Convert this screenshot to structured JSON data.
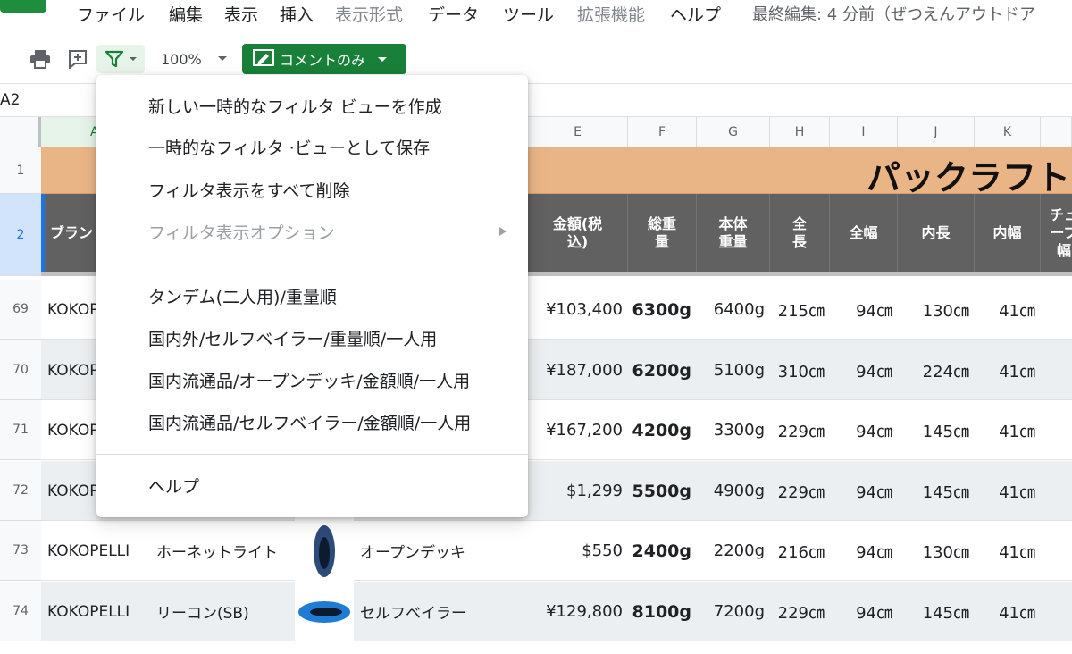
{
  "menubar": {
    "items": [
      {
        "label": "ファイル",
        "dim": false
      },
      {
        "label": "編集",
        "dim": false
      },
      {
        "label": "表示",
        "dim": false
      },
      {
        "label": "挿入",
        "dim": false
      },
      {
        "label": "表示形式",
        "dim": true
      },
      {
        "label": "データ",
        "dim": false
      },
      {
        "label": "ツール",
        "dim": false
      },
      {
        "label": "拡張機能",
        "dim": true
      },
      {
        "label": "ヘルプ",
        "dim": false
      }
    ],
    "last_edit": "最終編集: 4 分前（ぜつえんアウトドア"
  },
  "toolbar": {
    "print_icon": "printer-icon",
    "add_comment_icon": "add-comment-icon",
    "filter_icon": "filter-icon",
    "zoom": "100%",
    "comment_only_label": "コメントのみ",
    "comment_only_icon": "comment-edit-icon"
  },
  "formula_bar": {
    "name_box": "A2"
  },
  "grid": {
    "columns": [
      "A",
      "",
      "",
      "",
      "E",
      "F",
      "G",
      "H",
      "I",
      "J",
      "K",
      ""
    ],
    "title": "パックラフト比",
    "header_cells": [
      "ブラン",
      "金額(税\n込)",
      "総重\n量",
      "本体\n重量",
      "全\n長",
      "全幅",
      "内長",
      "内幅",
      "チュ\nーブ\n幅"
    ],
    "title_row_number": "1",
    "header_row_number": "2",
    "rows": [
      {
        "num": "69",
        "brand": "KOKOPELLI",
        "model": "",
        "type": "",
        "price": "¥103,400",
        "total_weight": "6300g",
        "body_weight": "6400g",
        "length": "215㎝",
        "width": "94㎝",
        "inner_length": "130㎝",
        "inner_width": "41㎝",
        "boat_color": ""
      },
      {
        "num": "70",
        "brand": "KOKOPELLI",
        "model": "",
        "type": "",
        "price": "¥187,000",
        "total_weight": "6200g",
        "body_weight": "5100g",
        "length": "310㎝",
        "width": "94㎝",
        "inner_length": "224㎝",
        "inner_width": "41㎝",
        "boat_color": ""
      },
      {
        "num": "71",
        "brand": "KOKOPELLI",
        "model": "",
        "type": "",
        "price": "¥167,200",
        "total_weight": "4200g",
        "body_weight": "3300g",
        "length": "229㎝",
        "width": "94㎝",
        "inner_length": "145㎝",
        "inner_width": "41㎝",
        "boat_color": ""
      },
      {
        "num": "72",
        "brand": "KOKOPELLI",
        "model": "",
        "type": "",
        "price": "$1,299",
        "total_weight": "5500g",
        "body_weight": "4900g",
        "length": "229㎝",
        "width": "94㎝",
        "inner_length": "145㎝",
        "inner_width": "41㎝",
        "boat_color": ""
      },
      {
        "num": "73",
        "brand": "KOKOPELLI",
        "model": "ホーネットライト",
        "type": "オープンデッキ",
        "price": "$550",
        "total_weight": "2400g",
        "body_weight": "2200g",
        "length": "216㎝",
        "width": "94㎝",
        "inner_length": "130㎝",
        "inner_width": "41㎝",
        "boat_color": "#2c4a7a"
      },
      {
        "num": "74",
        "brand": "KOKOPELLI",
        "model": "リーコン(SB)",
        "type": "セルフベイラー",
        "price": "¥129,800",
        "total_weight": "8100g",
        "body_weight": "7200g",
        "length": "229㎝",
        "width": "94㎝",
        "inner_length": "145㎝",
        "inner_width": "41㎝",
        "boat_color": "#1f7bd6"
      }
    ]
  },
  "filter_menu": {
    "create_temp": "新しい一時的なフィルタ ビューを作成",
    "save_temp": "一時的なフィルタ ·ビューとして保存",
    "delete_all": "フィルタ表示をすべて削除",
    "options": "フィルタ表示オプション",
    "views": [
      "タンデム(二人用)/重量順",
      "国内外/セルフベイラー/重量順/一人用",
      "国内流通品/オープンデッキ/金額順/一人用",
      "国内流通品/セルフベイラー/金額順/一人用"
    ],
    "help": "ヘルプ"
  },
  "colors": {
    "title_bg": "#eab586",
    "header_bg": "#616161",
    "accent_green": "#188038",
    "selection_blue": "#1a73e8"
  }
}
